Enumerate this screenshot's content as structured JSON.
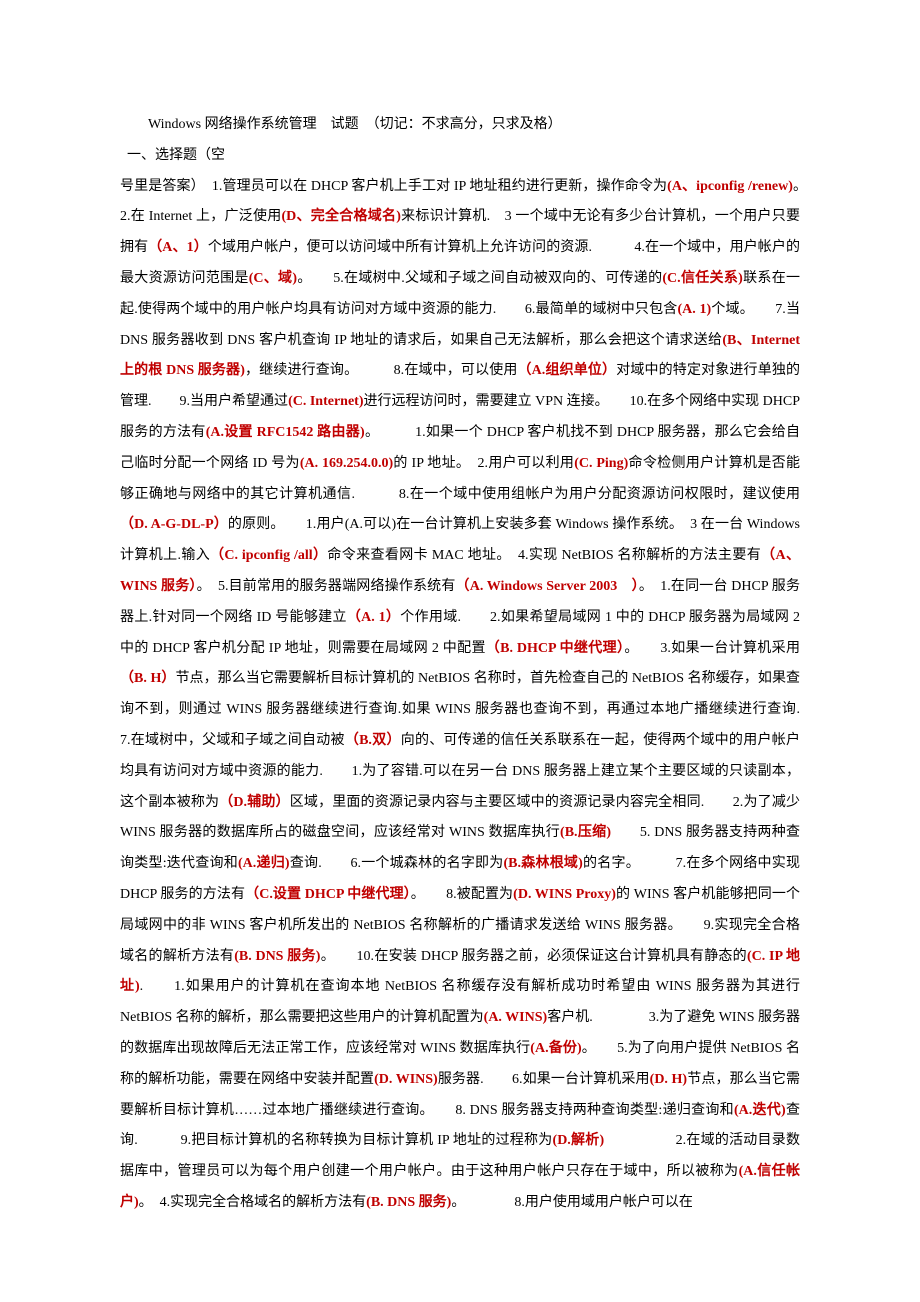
{
  "title": "Windows 网络操作系统管理　试题　（切记：不求高分，只求及格）",
  "section": "一、选择题（空",
  "lead": "号里是答案）　",
  "runs": [
    {
      "t": "1.管理员可以在 DHCP 客户机上手工对 IP 地址租约进行更新，操作命令为"
    },
    {
      "t": "(A、ipconfig /renew)",
      "a": true
    },
    {
      "t": "。　　2.在 Internet 上，广泛使用"
    },
    {
      "t": "(D、完全合格域名)",
      "a": true
    },
    {
      "t": "来标识计算机.　3 一个域中无论有多少台计算机，一个用户只要拥有"
    },
    {
      "t": "（A、1）",
      "a": true
    },
    {
      "t": "个域用户帐户，便可以访问域中所有计算机上允许访问的资源.　　　4.在一个域中，用户帐户的最大资源访问范围是"
    },
    {
      "t": "(C、域)",
      "a": true
    },
    {
      "t": "。　　5.在域树中.父域和子域之间自动被双向的、可传递的"
    },
    {
      "t": "(C.信任关系)",
      "a": true
    },
    {
      "t": "联系在一起.使得两个域中的用户帐户均具有访问对方域中资源的能力.　　6.最简单的域树中只包含"
    },
    {
      "t": "(A. 1)",
      "a": true
    },
    {
      "t": "个域。　　7.当 DNS 服务器收到 DNS 客户机查询 IP 地址的请求后，如果自己无法解析，那么会把这个请求送给"
    },
    {
      "t": "(B、Internet 上的根 DNS 服务器)",
      "a": true
    },
    {
      "t": "，继续进行查询。　　　8.在域中，可以使用"
    },
    {
      "t": "（A.组织单位）",
      "a": true
    },
    {
      "t": "对域中的特定对象进行单独的管理.　　9.当用户希望通过"
    },
    {
      "t": "(C. Internet)",
      "a": true
    },
    {
      "t": "进行远程访问时，需要建立 VPN 连接。　　10.在多个网络中实现 DHCP 服务的方法有"
    },
    {
      "t": "(A.设置 RFC1542 路由器)",
      "a": true
    },
    {
      "t": "。　　　1.如果一个 DHCP 客户机找不到 DHCP 服务器，那么它会给自己临时分配一个网络 ID 号为"
    },
    {
      "t": "(A. 169.254.0.0)",
      "a": true
    },
    {
      "t": "的 IP 地址。　2.用户可以利用"
    },
    {
      "t": "(C. Ping)",
      "a": true
    },
    {
      "t": "命令检侧用户计算机是否能够正确地与网络中的其它计算机通信.　　　8.在一个域中使用组帐户为用户分配资源访问权限时，建议使用"
    },
    {
      "t": "（D. A-G-DL-P）",
      "a": true
    },
    {
      "t": "的原则。　　1.用户(A.可以)在一台计算机上安装多套 Windows 操作系统。　3 在一台 Windows 计算机上.输入"
    },
    {
      "t": "（C. ipconfig /all）",
      "a": true
    },
    {
      "t": "命令来查看网卡 MAC 地址。　4.实现 NetBIOS 名称解析的方法主要有"
    },
    {
      "t": "（A、WINS 服务）",
      "a": true
    },
    {
      "t": "。　5.目前常用的服务器端网络操作系统有"
    },
    {
      "t": "（A. Windows Server 2003　）",
      "a": true
    },
    {
      "t": "。　1.在同一台 DHCP 服务器上.针对同一个网络 ID 号能够建立"
    },
    {
      "t": "（A. 1）",
      "a": true
    },
    {
      "t": "个作用域.　　2.如果希望局域网 1 中的 DHCP 服务器为局域网 2 中的 DHCP 客户机分配 IP 地址，则需要在局域网 2 中配置"
    },
    {
      "t": "（B. DHCP 中继代理）",
      "a": true
    },
    {
      "t": "。　　3.如果一台计算机采用"
    },
    {
      "t": "（B. H）",
      "a": true
    },
    {
      "t": "节点，那么当它需要解析目标计算机的 NetBIOS 名称时，首先检查自己的 NetBIOS 名称缓存，如果查询不到，则通过 WINS 服务器继续进行查询.如果 WINS 服务器也查询不到，再通过本地广播继续进行查询.　　　　7.在域树中，父域和子域之间自动被"
    },
    {
      "t": "（B.双）",
      "a": true
    },
    {
      "t": "向的、可传递的信任关系联系在一起，使得两个域中的用户帐户均具有访问对方域中资源的能力.　　1.为了容错.可以在另一台 DNS 服务器上建立某个主要区域的只读副本，这个副本被称为"
    },
    {
      "t": "（D.辅助）",
      "a": true
    },
    {
      "t": "区域，里面的资源记录内容与主要区域中的资源记录内容完全相同.　　2.为了减少 WINS 服务器的数据库所占的磁盘空间，应该经常对 WINS 数据库执行"
    },
    {
      "t": "(B.压缩)",
      "a": true
    },
    {
      "t": "　　5. DNS 服务器支持两种查询类型:迭代查询和"
    },
    {
      "t": "(A.递归)",
      "a": true
    },
    {
      "t": "查询.　　6.一个城森林的名字即为"
    },
    {
      "t": "(B.森林根域)",
      "a": true
    },
    {
      "t": "的名字。　　　7.在多个网络中实现 DHCP 服务的方法有"
    },
    {
      "t": "（C.设置 DHCP 中继代理）",
      "a": true
    },
    {
      "t": "。　　8.被配置为"
    },
    {
      "t": "(D. WINS Proxy)",
      "a": true
    },
    {
      "t": "的 WINS 客户机能够把同一个局域网中的非 WINS 客户机所发出的 NetBIOS 名称解析的广播请求发送给 WINS 服务器。　　9.实现完全合格域名的解析方法有"
    },
    {
      "t": "(B. DNS 服务)",
      "a": true
    },
    {
      "t": "。　　10.在安装 DHCP 服务器之前，必须保证这台计算机具有静态的"
    },
    {
      "t": "(C. IP 地址)",
      "a": true
    },
    {
      "t": ".　　1.如果用户的计算机在查询本地 NetBIOS 名称缓存没有解析成功时希望由 WINS 服务器为其进行 NetBIOS 名称的解析，那么需要把这些用户的计算机配置为"
    },
    {
      "t": "(A. WINS)",
      "a": true
    },
    {
      "t": "客户机.　　　　3.为了避免 WINS 服务器的数据库出现故障后无法正常工作，应该经常对 WINS 数据库执行"
    },
    {
      "t": "(A.备份)",
      "a": true
    },
    {
      "t": "。　　5.为了向用户提供 NetBIOS 名称的解析功能，需要在网络中安装并配置"
    },
    {
      "t": "(D. WINS)",
      "a": true
    },
    {
      "t": "服务器.　　6.如果一台计算机采用"
    },
    {
      "t": "(D. H)",
      "a": true
    },
    {
      "t": "节点，那么当它需要解析目标计算机……过本地广播继续进行查询。　　8. DNS 服务器支持两种查询类型:递归查询和"
    },
    {
      "t": "(A.迭代)",
      "a": true
    },
    {
      "t": "查询.　　　9.把目标计算机的名称转换为目标计算机 IP 地址的过程称为"
    },
    {
      "t": "(D.解析)",
      "a": true
    },
    {
      "t": "　　　　　2.在域的活动目录数据库中，管理员可以为每个用户创建一个用户帐户。由于这种用户帐户只存在于域中，所以被称为"
    },
    {
      "t": "(A.信任帐户)",
      "a": true
    },
    {
      "t": "。　4.实现完全合格域名的解析方法有"
    },
    {
      "t": "(B. DNS 服务)",
      "a": true
    },
    {
      "t": "。　　　　8.用户使用域用户帐户可以在"
    }
  ]
}
